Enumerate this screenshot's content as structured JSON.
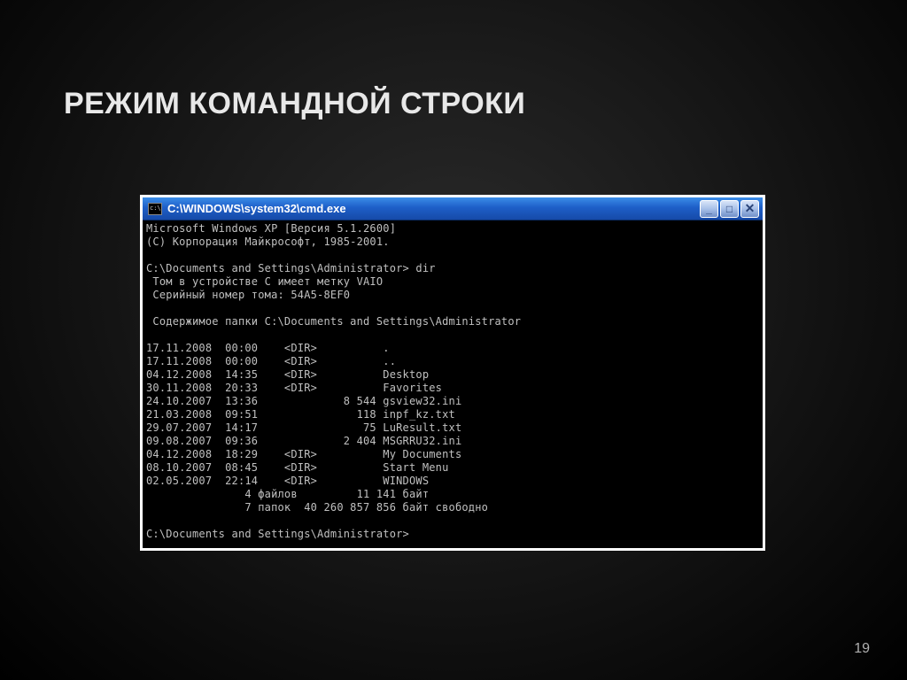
{
  "slide": {
    "title": "РЕЖИМ КОМАНДНОЙ СТРОКИ",
    "page_number": "19"
  },
  "window": {
    "title": "C:\\WINDOWS\\system32\\cmd.exe",
    "controls": {
      "min": "_",
      "max": "□",
      "close": "✕"
    }
  },
  "terminal": {
    "lines": [
      "Microsoft Windows XP [Версия 5.1.2600]",
      "(C) Корпорация Майкрософт, 1985-2001.",
      "",
      "C:\\Documents and Settings\\Administrator> dir",
      " Том в устройстве C имеет метку VAIO",
      " Серийный номер тома: 54A5-8EF0",
      "",
      " Содержимое папки C:\\Documents and Settings\\Administrator",
      "",
      "17.11.2008  00:00    <DIR>          .",
      "17.11.2008  00:00    <DIR>          ..",
      "04.12.2008  14:35    <DIR>          Desktop",
      "30.11.2008  20:33    <DIR>          Favorites",
      "24.10.2007  13:36             8 544 gsview32.ini",
      "21.03.2008  09:51               118 inpf_kz.txt",
      "29.07.2007  14:17                75 LuResult.txt",
      "09.08.2007  09:36             2 404 MSGRRU32.ini",
      "04.12.2008  18:29    <DIR>          My Documents",
      "08.10.2007  08:45    <DIR>          Start Menu",
      "02.05.2007  22:14    <DIR>          WINDOWS",
      "               4 файлов         11 141 байт",
      "               7 папок  40 260 857 856 байт свободно",
      "",
      "C:\\Documents and Settings\\Administrator>"
    ]
  }
}
